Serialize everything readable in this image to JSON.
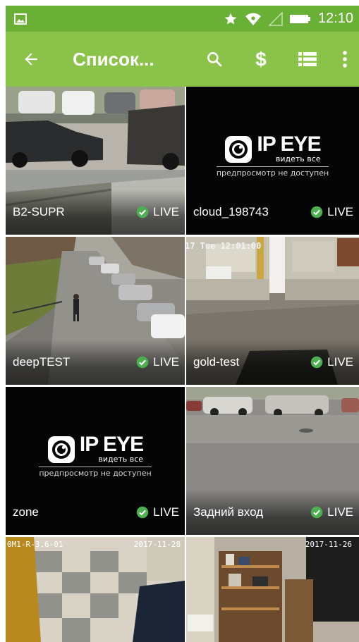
{
  "status_bar": {
    "time": "12:10",
    "icons": [
      "image-icon",
      "star-icon",
      "wifi-icon",
      "signal-icon",
      "battery-icon"
    ]
  },
  "app_bar": {
    "title": "Список...",
    "actions": [
      "search-icon",
      "dollar-icon",
      "list-view-icon",
      "more-vert-icon"
    ]
  },
  "colors": {
    "status_bar": "#6aaf36",
    "app_bar": "#8bc34a",
    "live_badge": "#4caf50"
  },
  "cameras": [
    {
      "name": "B2-SUPR",
      "status": "LIVE",
      "preview": "camera-snapshot"
    },
    {
      "name": "cloud_198743",
      "status": "LIVE",
      "preview": "placeholder",
      "placeholder": {
        "brand": "IP EYE",
        "slogan": "видеть все",
        "note": "предпросмотр не доступен"
      }
    },
    {
      "name": "deepTEST",
      "status": "LIVE",
      "preview": "camera-snapshot"
    },
    {
      "name": "gold-test",
      "status": "LIVE",
      "preview": "camera-snapshot",
      "overlay": "17 Tue 12:01:00"
    },
    {
      "name": "zone",
      "status": "LIVE",
      "preview": "placeholder",
      "placeholder": {
        "brand": "IP EYE",
        "slogan": "видеть все",
        "note": "предпросмотр не доступен"
      }
    },
    {
      "name": "Задний вход",
      "status": "LIVE",
      "preview": "camera-snapshot"
    },
    {
      "name": "",
      "status": "",
      "preview": "camera-snapshot",
      "overlay_left": "0M1-R-3.6-01",
      "overlay_right": "2017-11-28"
    },
    {
      "name": "",
      "status": "",
      "preview": "camera-snapshot",
      "overlay_right": "2017-11-26"
    }
  ]
}
